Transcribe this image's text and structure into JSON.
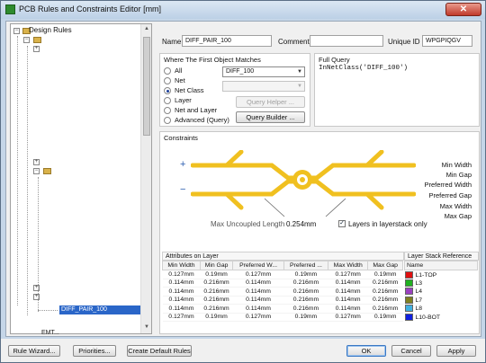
{
  "window": {
    "title": "PCB Rules and Constraints Editor [mm]",
    "close_label": "✕"
  },
  "tree": {
    "root_label": "Design Rules",
    "selected_label": "DIFF_PAIR_100",
    "bottom_label": "EMT..."
  },
  "rule": {
    "name_label": "Name",
    "name_value": "DIFF_PAIR_100",
    "comment_label": "Comment",
    "comment_value": "",
    "uid_label": "Unique ID",
    "uid_value": "WPGPIQGV"
  },
  "match": {
    "title": "Where The First Object Matches",
    "options": [
      {
        "label": "All",
        "selected": false
      },
      {
        "label": "Net",
        "selected": false
      },
      {
        "label": "Net Class",
        "selected": true
      },
      {
        "label": "Layer",
        "selected": false
      },
      {
        "label": "Net and Layer",
        "selected": false
      },
      {
        "label": "Advanced (Query)",
        "selected": false
      }
    ],
    "class_select": "DIFF_100",
    "second_select": "",
    "query_helper": "Query Helper ...",
    "query_builder": "Query Builder ..."
  },
  "full_query": {
    "title": "Full Query",
    "text": "InNetClass('DIFF_100')"
  },
  "constraints": {
    "title": "Constraints",
    "plus": "+",
    "minus": "−",
    "right_labels": [
      "Min Width",
      "Min Gap",
      "Preferred Width",
      "Preferred Gap",
      "Max Width",
      "Max Gap"
    ],
    "uncoupled_label": "Max Uncoupled Length",
    "uncoupled_value": "0.254mm",
    "layers_checkbox": "Layers in layerstack only",
    "layers_checked": true,
    "trace_color": "#f0c020"
  },
  "attr_table": {
    "title": "Attributes on Layer",
    "headers": [
      "Min Width",
      "Min Gap",
      "Preferred W...",
      "Preferred ...",
      "Max Width",
      "Max Gap"
    ],
    "rows": [
      [
        "0.127mm",
        "0.19mm",
        "0.127mm",
        "0.19mm",
        "0.127mm",
        "0.19mm"
      ],
      [
        "0.114mm",
        "0.216mm",
        "0.114mm",
        "0.216mm",
        "0.114mm",
        "0.216mm"
      ],
      [
        "0.114mm",
        "0.216mm",
        "0.114mm",
        "0.216mm",
        "0.114mm",
        "0.216mm"
      ],
      [
        "0.114mm",
        "0.216mm",
        "0.114mm",
        "0.216mm",
        "0.114mm",
        "0.216mm"
      ],
      [
        "0.114mm",
        "0.216mm",
        "0.114mm",
        "0.216mm",
        "0.114mm",
        "0.216mm"
      ],
      [
        "0.127mm",
        "0.19mm",
        "0.127mm",
        "0.19mm",
        "0.127mm",
        "0.19mm"
      ]
    ]
  },
  "stack_table": {
    "title": "Layer Stack Reference",
    "header": "Name",
    "rows": [
      {
        "name": "L1-TOP",
        "color": "#e01010"
      },
      {
        "name": "L3",
        "color": "#20b020"
      },
      {
        "name": "L4",
        "color": "#9a40c0"
      },
      {
        "name": "L7",
        "color": "#808020"
      },
      {
        "name": "L8",
        "color": "#40b0e0"
      },
      {
        "name": "L10-BOT",
        "color": "#1020e0"
      }
    ]
  },
  "buttons": {
    "rule_wizard": "Rule Wizard...",
    "priorities": "Priorities...",
    "create_default": "Create Default Rules",
    "ok": "OK",
    "cancel": "Cancel",
    "apply": "Apply"
  }
}
